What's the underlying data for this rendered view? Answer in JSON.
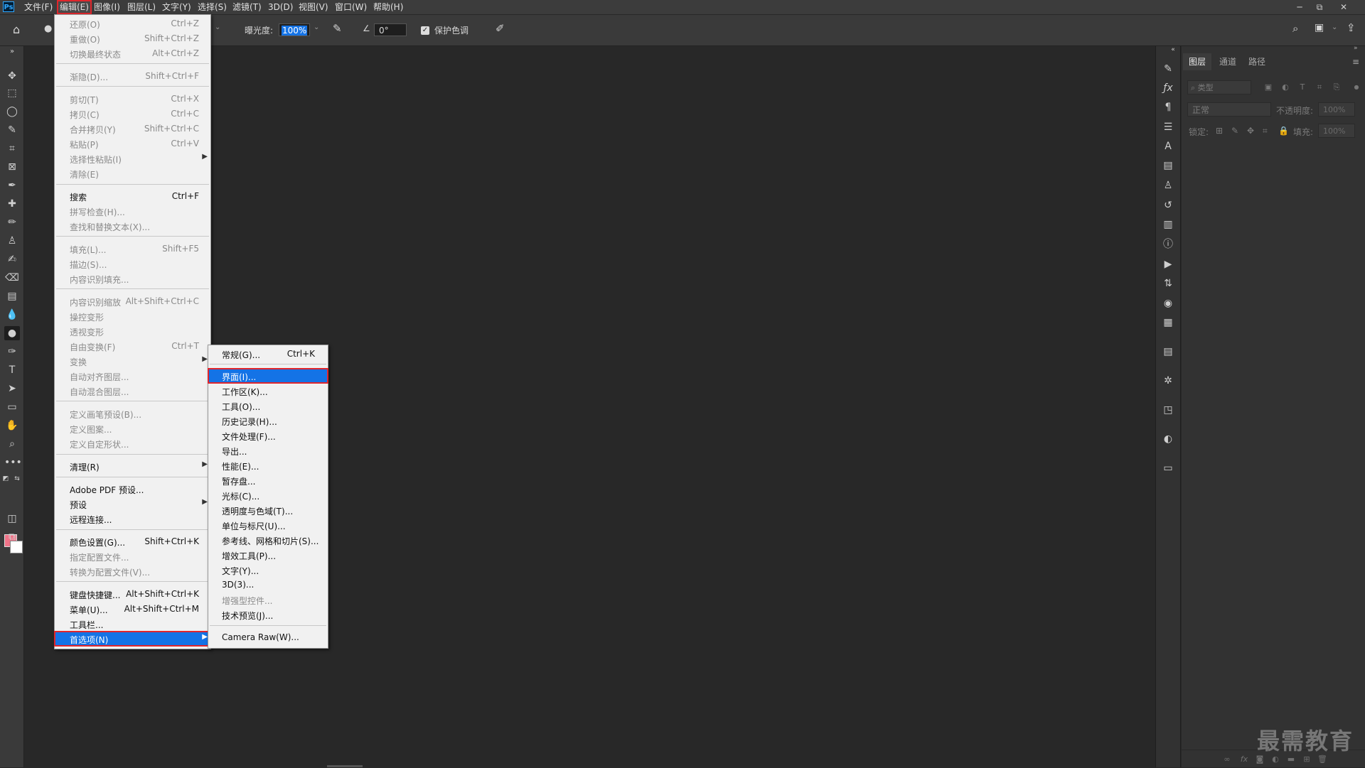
{
  "app": {
    "logo": "Ps"
  },
  "menubar": {
    "items": [
      "文件(F)",
      "编辑(E)",
      "图像(I)",
      "图层(L)",
      "文字(Y)",
      "选择(S)",
      "滤镜(T)",
      "3D(D)",
      "视图(V)",
      "窗口(W)",
      "帮助(H)"
    ],
    "active_index": 1
  },
  "window_controls": {
    "minimize": "─",
    "restore": "⧉",
    "close": "✕"
  },
  "options_bar": {
    "exposure_label": "曝光度:",
    "exposure_value": "100%",
    "angle_value": "0°",
    "protect_tones_label": "保护色调"
  },
  "edit_menu": {
    "items": [
      {
        "label": "还原(O)",
        "shortcut": "Ctrl+Z",
        "enabled": false
      },
      {
        "label": "重做(O)",
        "shortcut": "Shift+Ctrl+Z",
        "enabled": false
      },
      {
        "label": "切换最终状态",
        "shortcut": "Alt+Ctrl+Z",
        "enabled": false
      },
      {
        "label": "渐隐(D)...",
        "shortcut": "Shift+Ctrl+F",
        "enabled": false
      },
      {
        "label": "剪切(T)",
        "shortcut": "Ctrl+X",
        "enabled": false
      },
      {
        "label": "拷贝(C)",
        "shortcut": "Ctrl+C",
        "enabled": false
      },
      {
        "label": "合并拷贝(Y)",
        "shortcut": "Shift+Ctrl+C",
        "enabled": false
      },
      {
        "label": "粘贴(P)",
        "shortcut": "Ctrl+V",
        "enabled": false
      },
      {
        "label": "选择性粘贴(I)",
        "shortcut": "",
        "enabled": false,
        "submenu": true
      },
      {
        "label": "清除(E)",
        "shortcut": "",
        "enabled": false
      },
      {
        "label": "搜索",
        "shortcut": "Ctrl+F",
        "enabled": true
      },
      {
        "label": "拼写检查(H)...",
        "shortcut": "",
        "enabled": false
      },
      {
        "label": "查找和替换文本(X)...",
        "shortcut": "",
        "enabled": false
      },
      {
        "label": "填充(L)...",
        "shortcut": "Shift+F5",
        "enabled": false
      },
      {
        "label": "描边(S)...",
        "shortcut": "",
        "enabled": false
      },
      {
        "label": "内容识别填充...",
        "shortcut": "",
        "enabled": false
      },
      {
        "label": "内容识别缩放",
        "shortcut": "Alt+Shift+Ctrl+C",
        "enabled": false
      },
      {
        "label": "操控变形",
        "shortcut": "",
        "enabled": false
      },
      {
        "label": "透视变形",
        "shortcut": "",
        "enabled": false
      },
      {
        "label": "自由变换(F)",
        "shortcut": "Ctrl+T",
        "enabled": false
      },
      {
        "label": "变换",
        "shortcut": "",
        "enabled": false,
        "submenu": true
      },
      {
        "label": "自动对齐图层...",
        "shortcut": "",
        "enabled": false
      },
      {
        "label": "自动混合图层...",
        "shortcut": "",
        "enabled": false
      },
      {
        "label": "定义画笔预设(B)...",
        "shortcut": "",
        "enabled": false
      },
      {
        "label": "定义图案...",
        "shortcut": "",
        "enabled": false
      },
      {
        "label": "定义自定形状...",
        "shortcut": "",
        "enabled": false
      },
      {
        "label": "清理(R)",
        "shortcut": "",
        "enabled": true,
        "submenu": true
      },
      {
        "label": "Adobe PDF 预设...",
        "shortcut": "",
        "enabled": true
      },
      {
        "label": "预设",
        "shortcut": "",
        "enabled": true,
        "submenu": true
      },
      {
        "label": "远程连接...",
        "shortcut": "",
        "enabled": true
      },
      {
        "label": "颜色设置(G)...",
        "shortcut": "Shift+Ctrl+K",
        "enabled": true
      },
      {
        "label": "指定配置文件...",
        "shortcut": "",
        "enabled": false
      },
      {
        "label": "转换为配置文件(V)...",
        "shortcut": "",
        "enabled": false
      },
      {
        "label": "键盘快捷键...",
        "shortcut": "Alt+Shift+Ctrl+K",
        "enabled": true
      },
      {
        "label": "菜单(U)...",
        "shortcut": "Alt+Shift+Ctrl+M",
        "enabled": true
      },
      {
        "label": "工具栏...",
        "shortcut": "",
        "enabled": true
      },
      {
        "label": "首选项(N)",
        "shortcut": "",
        "enabled": true,
        "submenu": true,
        "highlighted": true
      }
    ]
  },
  "preferences_submenu": {
    "items": [
      {
        "label": "常规(G)...",
        "shortcut": "Ctrl+K",
        "enabled": true
      },
      {
        "label": "界面(I)...",
        "shortcut": "",
        "enabled": true,
        "highlighted": true
      },
      {
        "label": "工作区(K)...",
        "shortcut": "",
        "enabled": true
      },
      {
        "label": "工具(O)...",
        "shortcut": "",
        "enabled": true
      },
      {
        "label": "历史记录(H)...",
        "shortcut": "",
        "enabled": true
      },
      {
        "label": "文件处理(F)...",
        "shortcut": "",
        "enabled": true
      },
      {
        "label": "导出...",
        "shortcut": "",
        "enabled": true
      },
      {
        "label": "性能(E)...",
        "shortcut": "",
        "enabled": true
      },
      {
        "label": "暂存盘...",
        "shortcut": "",
        "enabled": true
      },
      {
        "label": "光标(C)...",
        "shortcut": "",
        "enabled": true
      },
      {
        "label": "透明度与色域(T)...",
        "shortcut": "",
        "enabled": true
      },
      {
        "label": "单位与标尺(U)...",
        "shortcut": "",
        "enabled": true
      },
      {
        "label": "参考线、网格和切片(S)...",
        "shortcut": "",
        "enabled": true
      },
      {
        "label": "增效工具(P)...",
        "shortcut": "",
        "enabled": true
      },
      {
        "label": "文字(Y)...",
        "shortcut": "",
        "enabled": true
      },
      {
        "label": "3D(3)...",
        "shortcut": "",
        "enabled": true
      },
      {
        "label": "增强型控件...",
        "shortcut": "",
        "enabled": false
      },
      {
        "label": "技术预览(J)...",
        "shortcut": "",
        "enabled": true
      },
      {
        "label": "Camera Raw(W)...",
        "shortcut": "",
        "enabled": true
      }
    ]
  },
  "layers_panel": {
    "tabs": [
      "图层",
      "通道",
      "路径"
    ],
    "active_tab": 0,
    "filter_placeholder": "类型",
    "blend_mode": "正常",
    "opacity_label": "不透明度:",
    "opacity_value": "100%",
    "lock_label": "锁定:",
    "fill_label": "填充:",
    "fill_value": "100%"
  },
  "watermark": "最需教育",
  "colors": {
    "foreground": "#f07388",
    "background": "#ffffff",
    "accent": "#1473e6",
    "highlight_border": "#e0262c"
  }
}
